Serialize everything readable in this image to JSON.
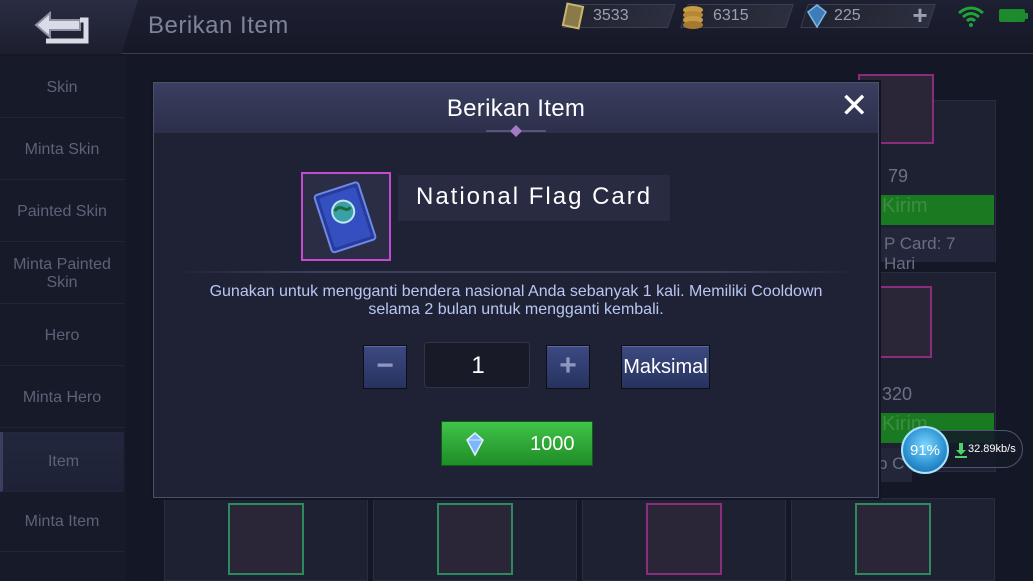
{
  "topbar": {
    "title": "Berikan Item",
    "currencies": [
      {
        "icon": "ticket-icon",
        "value": "3533"
      },
      {
        "icon": "battle-point-coins-icon",
        "value": "6315"
      },
      {
        "icon": "diamond-icon",
        "value": "225"
      }
    ]
  },
  "sidebar": {
    "items": [
      {
        "label": "Skin"
      },
      {
        "label": "Minta Skin"
      },
      {
        "label": "Painted Skin"
      },
      {
        "label": "Minta Painted Skin"
      },
      {
        "label": "Hero"
      },
      {
        "label": "Minta Hero"
      },
      {
        "label": "Item"
      },
      {
        "label": "Minta Item"
      }
    ],
    "active_index": 6
  },
  "background": {
    "value_1": "79",
    "send_label_1": "Kirim",
    "vip_text": "P Card: 7 Hari",
    "value_2": "320",
    "send_label_2": "Kirim",
    "vip_text_2": "p C"
  },
  "modal": {
    "title": "Berikan Item",
    "item_name": "National Flag Card",
    "item_icon": "national-flag-card-icon",
    "description": "Gunakan untuk mengganti bendera nasional Anda sebanyak 1 kali. Memiliki Cooldown selama 2 bulan untuk mengganti kembali.",
    "quantity": "1",
    "minus_label": "−",
    "plus_label": "+",
    "max_label": "Maksimal",
    "price": "1000",
    "price_icon": "diamond-icon"
  },
  "network": {
    "percent": "91%",
    "speed": "32.89kb/s"
  },
  "colors": {
    "accent_green": "#1e8d27",
    "button_blue": "#27325e",
    "thumb_border": "#c64ad1"
  }
}
